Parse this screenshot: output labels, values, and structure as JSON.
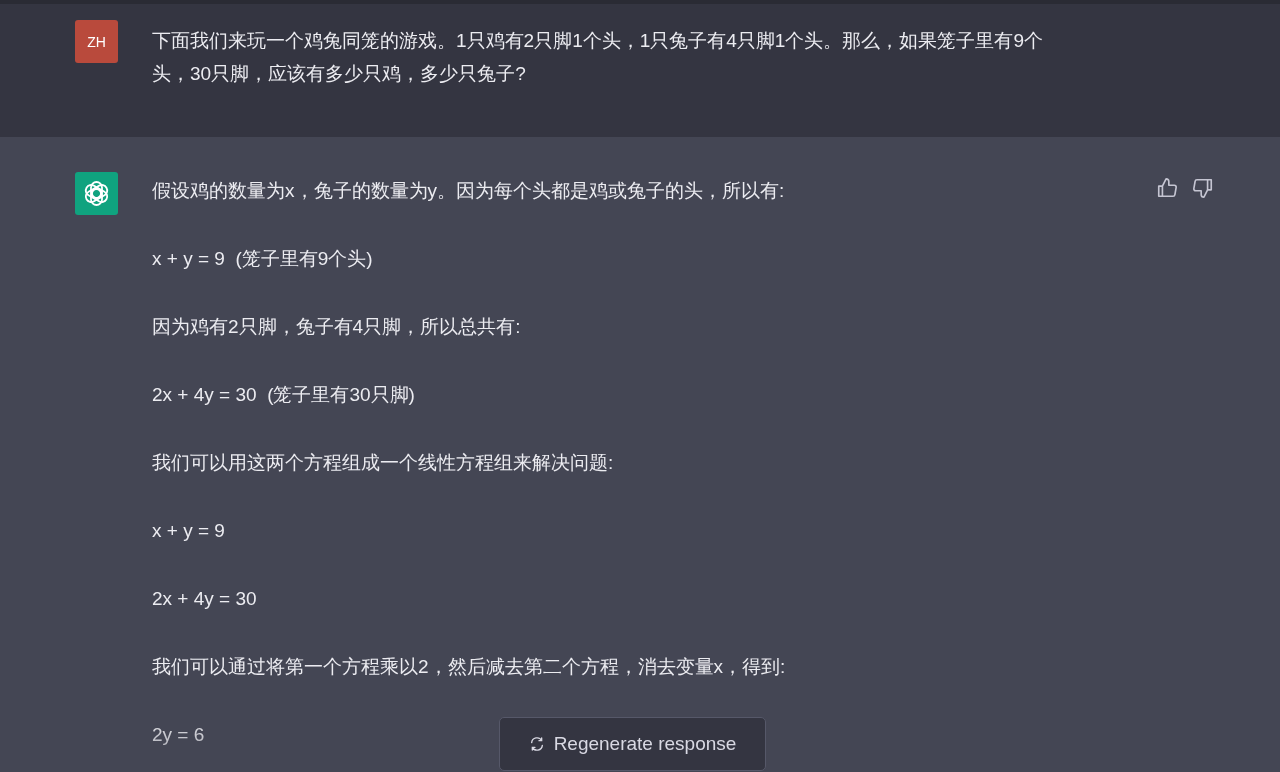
{
  "user_message": {
    "avatar": "ZH",
    "text": "下面我们来玩一个鸡兔同笼的游戏。1只鸡有2只脚1个头，1只兔子有4只脚1个头。那么，如果笼子里有9个头，30只脚，应该有多少只鸡，多少只兔子?"
  },
  "assistant_message": {
    "paragraphs": [
      "假设鸡的数量为x，兔子的数量为y。因为每个头都是鸡或兔子的头，所以有:",
      "x + y = 9  (笼子里有9个头)",
      "因为鸡有2只脚，兔子有4只脚，所以总共有:",
      "2x + 4y = 30  (笼子里有30只脚)",
      "我们可以用这两个方程组成一个线性方程组来解决问题:",
      "x + y = 9",
      "2x + 4y = 30",
      "我们可以通过将第一个方程乘以2，然后减去第二个方程，消去变量x，得到:",
      "2y = 6"
    ]
  },
  "regenerate_button": {
    "label": "Regenerate response"
  }
}
